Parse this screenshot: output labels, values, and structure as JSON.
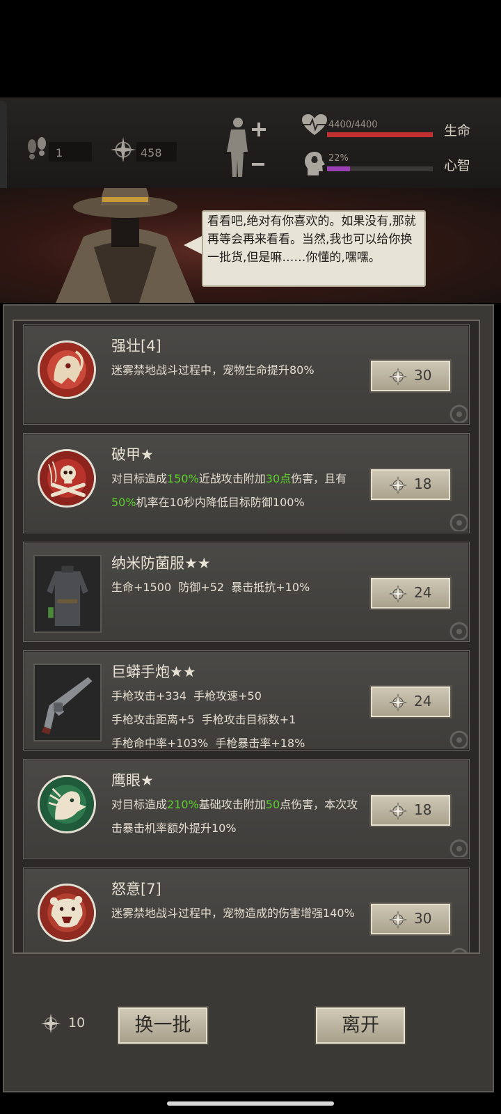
{
  "status": {
    "steps": "1",
    "currency": "458",
    "health": {
      "text": "4400/4400",
      "label": "生命",
      "fraction": 1.0,
      "color": "#c0302e"
    },
    "sanity": {
      "text": "22%",
      "label": "心智",
      "fraction": 0.22,
      "color": "#9b3fb5"
    }
  },
  "dialog": {
    "text": "看看吧,绝对有你喜欢的。如果没有,那就再等会再来看看。当然,我也可以给你换一批货,但是嘛……你懂的,嘿嘿。"
  },
  "items": [
    {
      "title": "强壮[4]",
      "desc": [
        "迷雾禁地战斗过程中，宠物生命提升80%"
      ],
      "price": "30"
    },
    {
      "title": "破甲★",
      "desc_parts": [
        "对目标造成",
        "150%",
        "近战攻击附加",
        "30点",
        "伤害，且有",
        "50%",
        "机率在10秒内降低目标防御100%"
      ],
      "price": "18"
    },
    {
      "title": "纳米防菌服★★",
      "desc": [
        "生命+1500  防御+52  暴击抵抗+10%"
      ],
      "price": "24"
    },
    {
      "title": "巨蟒手炮★★",
      "desc": [
        "手枪攻击+334  手枪攻速+50",
        "手枪攻击距离+5  手枪攻击目标数+1",
        "手枪命中率+103%  手枪暴击率+18%"
      ],
      "price": "24"
    },
    {
      "title": "鹰眼★",
      "desc_parts": [
        "对目标造成",
        "210%",
        "基础攻击附加",
        "50",
        "点伤害，本次攻击暴击机率额外提升10%"
      ],
      "price": "18"
    },
    {
      "title": "怒意[7]",
      "desc": [
        "迷雾禁地战斗过程中，宠物造成的伤害增强140%"
      ],
      "price": "30"
    }
  ],
  "footer": {
    "refresh_cost": "10",
    "refresh_label": "换一批",
    "leave_label": "离开"
  },
  "icons": {
    "currency": "compass-star-icon",
    "steps": "footprints-icon",
    "health": "heart-icon",
    "sanity": "brain-head-icon"
  },
  "colors": {
    "highlight": "#5dd12b",
    "button": "#c8c1ad"
  }
}
